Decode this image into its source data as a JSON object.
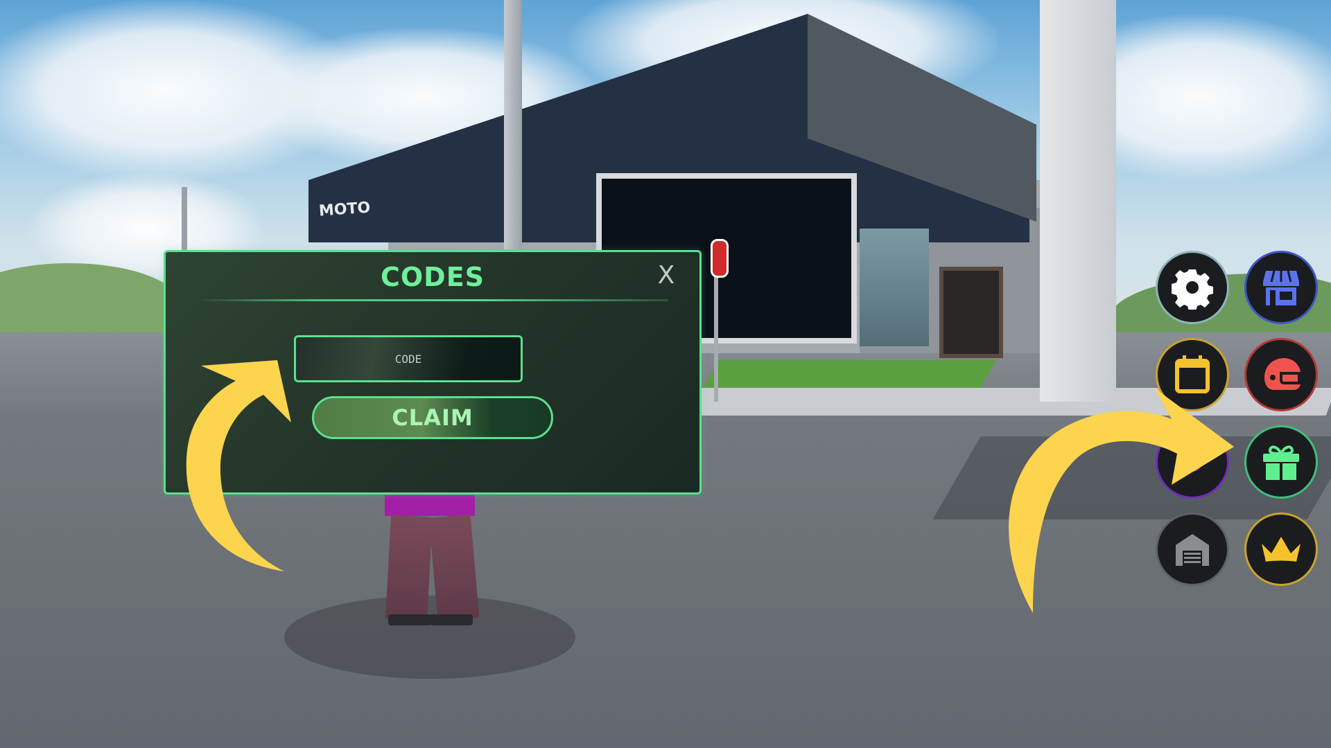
{
  "scene": {
    "building_sign": "MOTO"
  },
  "codes_panel": {
    "title": "CODES",
    "close_label": "X",
    "input_value": "",
    "input_placeholder": "CODE",
    "claim_label": "CLAIM"
  },
  "hud_buttons": [
    {
      "name": "settings",
      "icon": "gear-icon",
      "color": "#ffffff",
      "border": "#8fb5b8"
    },
    {
      "name": "shop",
      "icon": "store-icon",
      "color": "#5b72f0",
      "border": "#3f54c4"
    },
    {
      "name": "daily-rewards",
      "icon": "calendar-icon",
      "color": "#f5c12e",
      "border": "#c9a42a"
    },
    {
      "name": "helmets",
      "icon": "helmet-icon",
      "color": "#f0534e",
      "border": "#b53a36"
    },
    {
      "name": "events",
      "icon": "purple-icon",
      "color": "#8a35e0",
      "border": "#6d2cc0"
    },
    {
      "name": "codes",
      "icon": "gift-icon",
      "color": "#5ef08f",
      "border": "#3fbf78"
    },
    {
      "name": "garage",
      "icon": "garage-icon",
      "color": "#8a8d90",
      "border": "#5c6368"
    },
    {
      "name": "vip",
      "icon": "crown-icon",
      "color": "#f5c32e",
      "border": "#c9a42a"
    }
  ],
  "annotations": {
    "arrow_color": "#fdd44e"
  }
}
